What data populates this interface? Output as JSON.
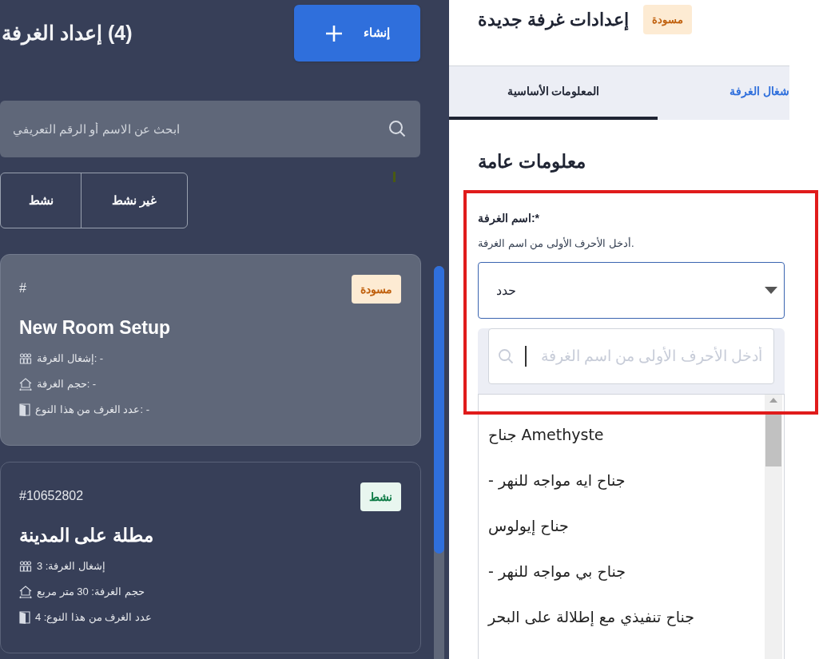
{
  "sidebar": {
    "title": "(4) إعداد الغرفة",
    "create_button": "إنشاء",
    "search": {
      "placeholder": "ابحث عن الاسم أو الرقم التعريفي"
    },
    "filters": [
      {
        "label": "غير نشط"
      },
      {
        "label": "نشط"
      }
    ],
    "cards": [
      {
        "selected": true,
        "kind": "draft",
        "badge": "مسودة",
        "id": "#",
        "name": "New Room Setup",
        "details": [
          {
            "kind": "occupancy",
            "text": "إشغال الغرفة: -"
          },
          {
            "kind": "size",
            "text": "حجم الغرفة: -"
          },
          {
            "kind": "count",
            "text": "عدد الغرف من هذا النوع: -"
          }
        ]
      },
      {
        "selected": false,
        "kind": "active",
        "badge": "نشط",
        "id": "#10652802",
        "name": "مطلة على المدينة",
        "details": [
          {
            "kind": "occupancy",
            "text": "إشغال الغرفة: 3"
          },
          {
            "kind": "size",
            "text": "حجم الغرفة: 30 متر مربع"
          },
          {
            "kind": "count",
            "text": "عدد الغرف من هذا النوع: 4"
          }
        ]
      }
    ]
  },
  "editor": {
    "title": "إعدادات غرفة جديدة",
    "badge": "مسودة",
    "tabs": [
      {
        "label": "شغال الغرفة",
        "selected": false
      },
      {
        "label": "المعلومات الأساسية",
        "selected": true
      }
    ],
    "section_title": "معلومات عامة",
    "field": {
      "label": "اسم الغرفة:*",
      "hint": "أدخل الأحرف الأولى من اسم الغرفة.",
      "value": "حدد",
      "dropdown": {
        "search_placeholder": "أدخل الأحرف الأولى من اسم الغرفة",
        "options": [
          "جناح Amethyste",
          "- جناح ايه مواجه للنهر",
          "جناح إيولوس",
          "- جناح بي مواجه للنهر",
          "جناح تنفيذي مع إطلالة على البحر"
        ]
      }
    }
  }
}
